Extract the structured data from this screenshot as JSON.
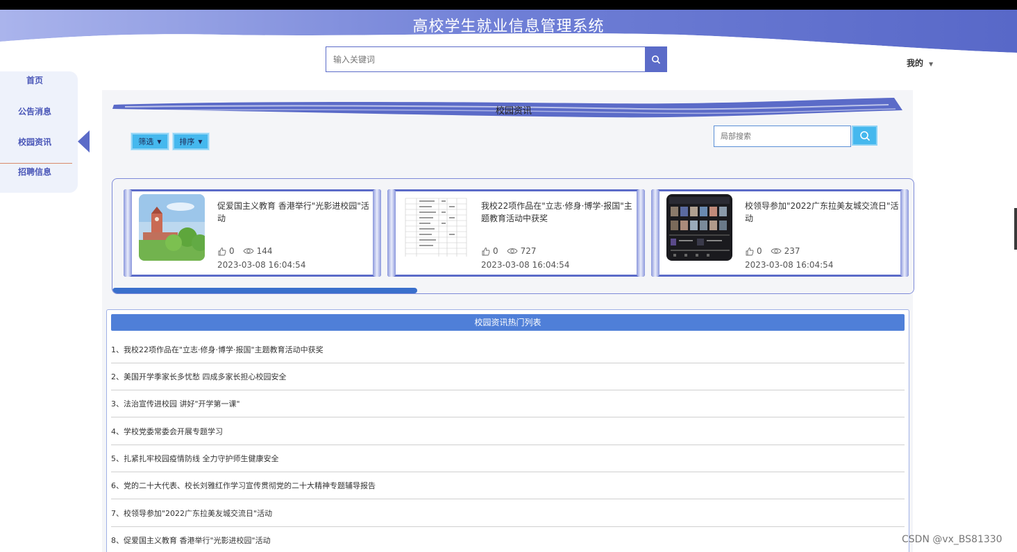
{
  "header": {
    "title": "高校学生就业信息管理系统",
    "search_placeholder": "输入关键词",
    "user_menu": "我的"
  },
  "sidebar": {
    "items": [
      {
        "label": "首页"
      },
      {
        "label": "公告消息"
      },
      {
        "label": "校园资讯",
        "active": true
      },
      {
        "label": "招聘信息"
      }
    ]
  },
  "section": {
    "title": "校园资讯",
    "filter_label": "筛选",
    "sort_label": "排序",
    "local_search_placeholder": "局部搜索"
  },
  "carousel": {
    "cards": [
      {
        "title": "促爱国主义教育 香港举行\"光影进校园\"活动",
        "likes": "0",
        "views": "144",
        "date": "2023-03-08 16:04:54"
      },
      {
        "title": "我校22项作品在\"立志·修身·博学·报国\"主题教育活动中获奖",
        "likes": "0",
        "views": "727",
        "date": "2023-03-08 16:04:54"
      },
      {
        "title": "校领导参加\"2022广东拉美友城交流日\"活动",
        "likes": "0",
        "views": "237",
        "date": "2023-03-08 16:04:54"
      }
    ],
    "scroll_progress": 0.38
  },
  "hot_list": {
    "header": "校园资讯热门列表",
    "items": [
      "1、我校22项作品在\"立志·修身·博学·报国\"主题教育活动中获奖",
      "2、美国开学季家长多忧愁 四成多家长担心校园安全",
      "3、法治宣传进校园 讲好\"开学第一课\"",
      "4、学校党委常委会开展专题学习",
      "5、扎紧扎牢校园疫情防线 全力守护师生健康安全",
      "6、党的二十大代表、校长刘雅红作学习宣传贯彻党的二十大精神专题辅导报告",
      "7、校领导参加\"2022广东拉美友城交流日\"活动",
      "8、促爱国主义教育 香港举行\"光影进校园\"活动"
    ]
  },
  "watermark": "CSDN @vx_BS81330",
  "colors": {
    "primary": "#5b6bc8",
    "accent_light_blue": "#45b8ee",
    "list_header": "#4f7fd8"
  }
}
